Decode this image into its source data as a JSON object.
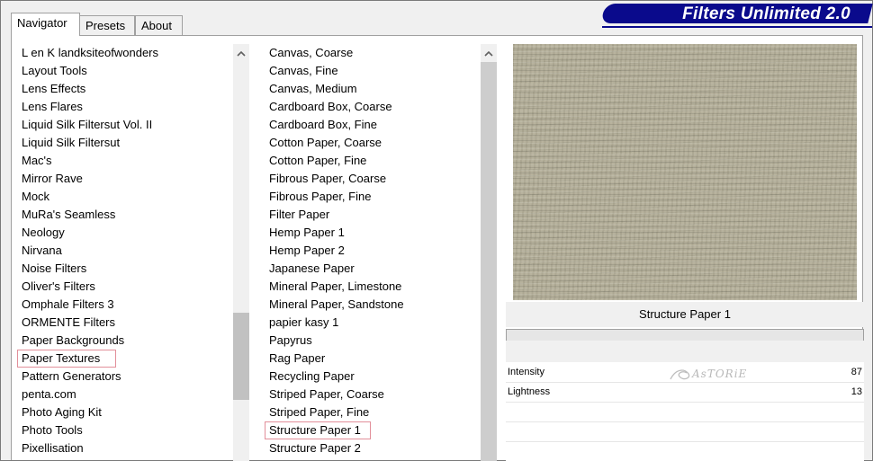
{
  "brand": {
    "title": "Filters Unlimited 2.0",
    "color": "#0a0a8c"
  },
  "tabs": [
    {
      "label": "Navigator",
      "active": true
    },
    {
      "label": "Presets",
      "active": false
    },
    {
      "label": "About",
      "active": false
    }
  ],
  "categories": {
    "items": [
      "L en K landksiteofwonders",
      "Layout Tools",
      "Lens Effects",
      "Lens Flares",
      "Liquid Silk Filtersut Vol. II",
      "Liquid Silk Filtersut",
      "Mac's",
      "Mirror Rave",
      "Mock",
      "MuRa's Seamless",
      "Neology",
      "Nirvana",
      "Noise Filters",
      "Oliver's Filters",
      "Omphale Filters 3",
      "ORMENTE Filters",
      "Paper Backgrounds",
      "Paper Textures",
      "Pattern Generators",
      "penta.com",
      "Photo Aging Kit",
      "Photo Tools",
      "Pixellisation"
    ],
    "selected": "Paper Textures"
  },
  "filters": {
    "items": [
      "Canvas, Coarse",
      "Canvas, Fine",
      "Canvas, Medium",
      "Cardboard Box, Coarse",
      "Cardboard Box, Fine",
      "Cotton Paper, Coarse",
      "Cotton Paper, Fine",
      "Fibrous Paper, Coarse",
      "Fibrous Paper, Fine",
      "Filter Paper",
      "Hemp Paper 1",
      "Hemp Paper 2",
      "Japanese Paper",
      "Mineral Paper, Limestone",
      "Mineral Paper, Sandstone",
      "papier kasy 1",
      "Papyrus",
      "Rag Paper",
      "Recycling Paper",
      "Striped Paper, Coarse",
      "Striped Paper, Fine",
      "Structure Paper 1",
      "Structure Paper 2"
    ],
    "selected": "Structure Paper 1"
  },
  "preview": {
    "filter_name": "Structure Paper 1",
    "texture_color": "#b3ae98"
  },
  "parameters": [
    {
      "label": "Intensity",
      "value": "87"
    },
    {
      "label": "Lightness",
      "value": "13"
    }
  ],
  "watermark": "AsTORiE",
  "selection_outline_color": "#e28f9a"
}
